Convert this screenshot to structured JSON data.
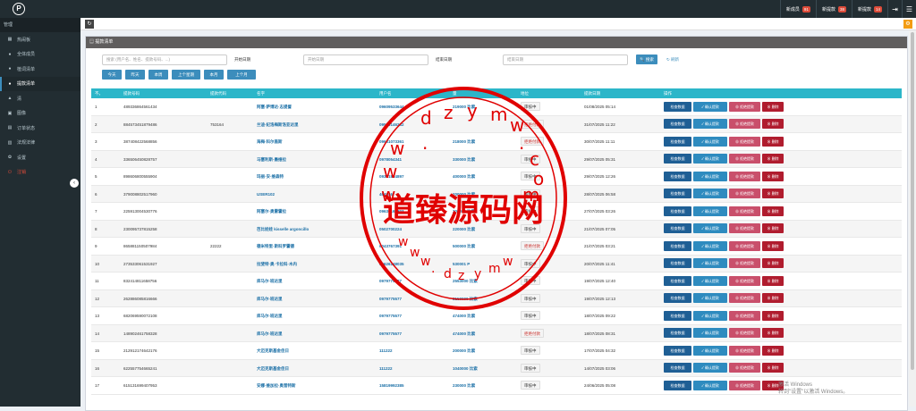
{
  "topbar": {
    "logo_text": "P",
    "badges": [
      {
        "label": "新成员",
        "count": "91"
      },
      {
        "label": "新提款",
        "count": "38"
      },
      {
        "label": "新提款",
        "count": "14"
      }
    ],
    "icons": [
      "logout-icon",
      "menu-icon"
    ]
  },
  "sidebar": {
    "section": "管理",
    "items": [
      {
        "label": "热闹板",
        "icon": "dashboard-icon"
      },
      {
        "label": "全体成员",
        "icon": "users-icon"
      },
      {
        "label": "植词清单",
        "icon": "list-icon"
      },
      {
        "label": "提款清单",
        "icon": "withdraw-icon"
      },
      {
        "label": "清",
        "icon": "cart-icon"
      },
      {
        "label": "图像",
        "icon": "image-icon"
      },
      {
        "label": "订单状态",
        "icon": "order-icon"
      },
      {
        "label": "法规法律",
        "icon": "law-icon"
      },
      {
        "label": "设置",
        "icon": "gear-icon"
      },
      {
        "label": "注销",
        "icon": "power-icon"
      }
    ]
  },
  "panel": {
    "title": "提款清单",
    "search_placeholder": "搜索 (用户名、姓名、提款号码、...)",
    "start_label": "开始日期",
    "start_placeholder": "开始日期",
    "end_label": "结束日期",
    "end_placeholder": "结束日期",
    "search_button": "搜索",
    "reset_button": "刷新",
    "quick_filters": [
      "今天",
      "昨天",
      "本周",
      "上个星期",
      "本月",
      "上个月"
    ]
  },
  "table": {
    "headers": [
      "不。",
      "提款号码",
      "提款代码",
      "名字",
      "用户名",
      "量",
      "地位",
      "提款日期",
      "操作"
    ],
    "action_labels": [
      "检查数据",
      "确认提款",
      "拒绝提款",
      "删除"
    ],
    "rows": [
      {
        "no": "1",
        "code": "489336864561434",
        "code2": "",
        "name": "阿塞·萨博达·志提督",
        "user": "09609533644",
        "amount": "219000 比索",
        "status": "审核中",
        "date": "01/08/2025 05:14"
      },
      {
        "no": "2",
        "code": "884573451879486",
        "code2": "753164",
        "name": "兰迪·纪洛梅斯洛亚达里",
        "user": "09599146232",
        "amount": "",
        "status": "拒绝付款",
        "date": "31/07/2025 11:22"
      },
      {
        "no": "3",
        "code": "387408422568856",
        "code2": "",
        "name": "海梅·科尔盖斯",
        "user": "09631073361",
        "amount": "218000 比索",
        "status": "拒绝付款",
        "date": "30/07/2025 11:11"
      },
      {
        "no": "4",
        "code": "336506450828757",
        "code2": "",
        "name": "马塞利斯·墨维拉",
        "user": "0978054341",
        "amount": "330000 比索",
        "status": "审核中",
        "date": "29/07/2025 05:31"
      },
      {
        "no": "5",
        "code": "898606800555904",
        "code2": "",
        "name": "玛丽·安·维森特",
        "user": "09331864897",
        "amount": "400000 比索",
        "status": "审核中",
        "date": "29/07/2025 12:26"
      },
      {
        "no": "6",
        "code": "379008802517960",
        "code2": "",
        "name": "USER102",
        "user": "464646",
        "amount": "200000 比索",
        "status": "审核中",
        "date": "28/07/2025 06:58"
      },
      {
        "no": "7",
        "code": "225913004530776",
        "code2": "",
        "name": "阿塞尔·奥雷霍拉",
        "user": "09630163393",
        "amount": "300000 比索",
        "status": "审核中",
        "date": "27/07/2025 03:26"
      },
      {
        "no": "8",
        "code": "230095737815258",
        "code2": "",
        "name": "芭比娃娃 kisselle argoncillo",
        "user": "0502700224",
        "amount": "220000 比索",
        "status": "审核中",
        "date": "21/07/2025 07:05"
      },
      {
        "no": "9",
        "code": "865881150507984",
        "code2": "22222",
        "name": "德米特里·斯科罗霍德",
        "user": "6043767391",
        "amount": "500000 比索",
        "status": "拒绝付款",
        "date": "21/07/2025 03:21"
      },
      {
        "no": "10",
        "code": "273533061531927",
        "code2": "",
        "name": "拉斐特·奥·卡拉科·木内",
        "user": "09626148035",
        "amount": "530001 P",
        "status": "审核中",
        "date": "20/07/2025 11:41"
      },
      {
        "no": "11",
        "code": "832414811658756",
        "code2": "",
        "name": "库马尔·班达里",
        "user": "0979775577",
        "amount": "2553000 比索",
        "status": "审核中",
        "date": "19/07/2025 12:40"
      },
      {
        "no": "12",
        "code": "262886085816666",
        "code2": "",
        "name": "库马尔·班达里",
        "user": "0979775577",
        "amount": "2150000 比索",
        "status": "审核中",
        "date": "19/07/2025 12:13"
      },
      {
        "no": "13",
        "code": "682069590072108",
        "code2": "",
        "name": "库马尔·班达里",
        "user": "0979775577",
        "amount": "474000 比索",
        "status": "审核中",
        "date": "18/07/2025 09:22"
      },
      {
        "no": "14",
        "code": "148902461758328",
        "code2": "",
        "name": "库马尔·班达里",
        "user": "0979775577",
        "amount": "474000 比索",
        "status": "拒绝付款",
        "date": "18/07/2025 08:31"
      },
      {
        "no": "15",
        "code": "212912174642176",
        "code2": "",
        "name": "大迈克斯基金佳日",
        "user": "111222",
        "amount": "200000 比索",
        "status": "审核中",
        "date": "17/07/2025 04:32"
      },
      {
        "no": "16",
        "code": "622557754665241",
        "code2": "",
        "name": "大迈克斯基金佳日",
        "user": "111222",
        "amount": "1040000 比索",
        "status": "审核中",
        "date": "14/07/2025 03:06"
      },
      {
        "no": "17",
        "code": "615131699407953",
        "code2": "",
        "name": "安娜·维加拉·奥普特斯",
        "user": "15819992385",
        "amount": "230000 比索",
        "status": "审核中",
        "date": "24/06/2025 05:08"
      }
    ]
  },
  "watermark": {
    "main": "道臻源码网",
    "letters": [
      "w",
      "w",
      "w",
      ".",
      "d",
      "z",
      "y",
      "m",
      "w",
      ".",
      "c",
      "o",
      "m"
    ]
  },
  "windows_activation": {
    "line1": "激活 Windows",
    "line2": "转到\"设置\"以激活 Windows。"
  },
  "colors": {
    "sidebar_bg": "#222d32",
    "table_header": "#2cb6c9",
    "primary_button": "#3c8dbc",
    "danger": "#b01c2e",
    "watermark_red": "#e00000"
  }
}
